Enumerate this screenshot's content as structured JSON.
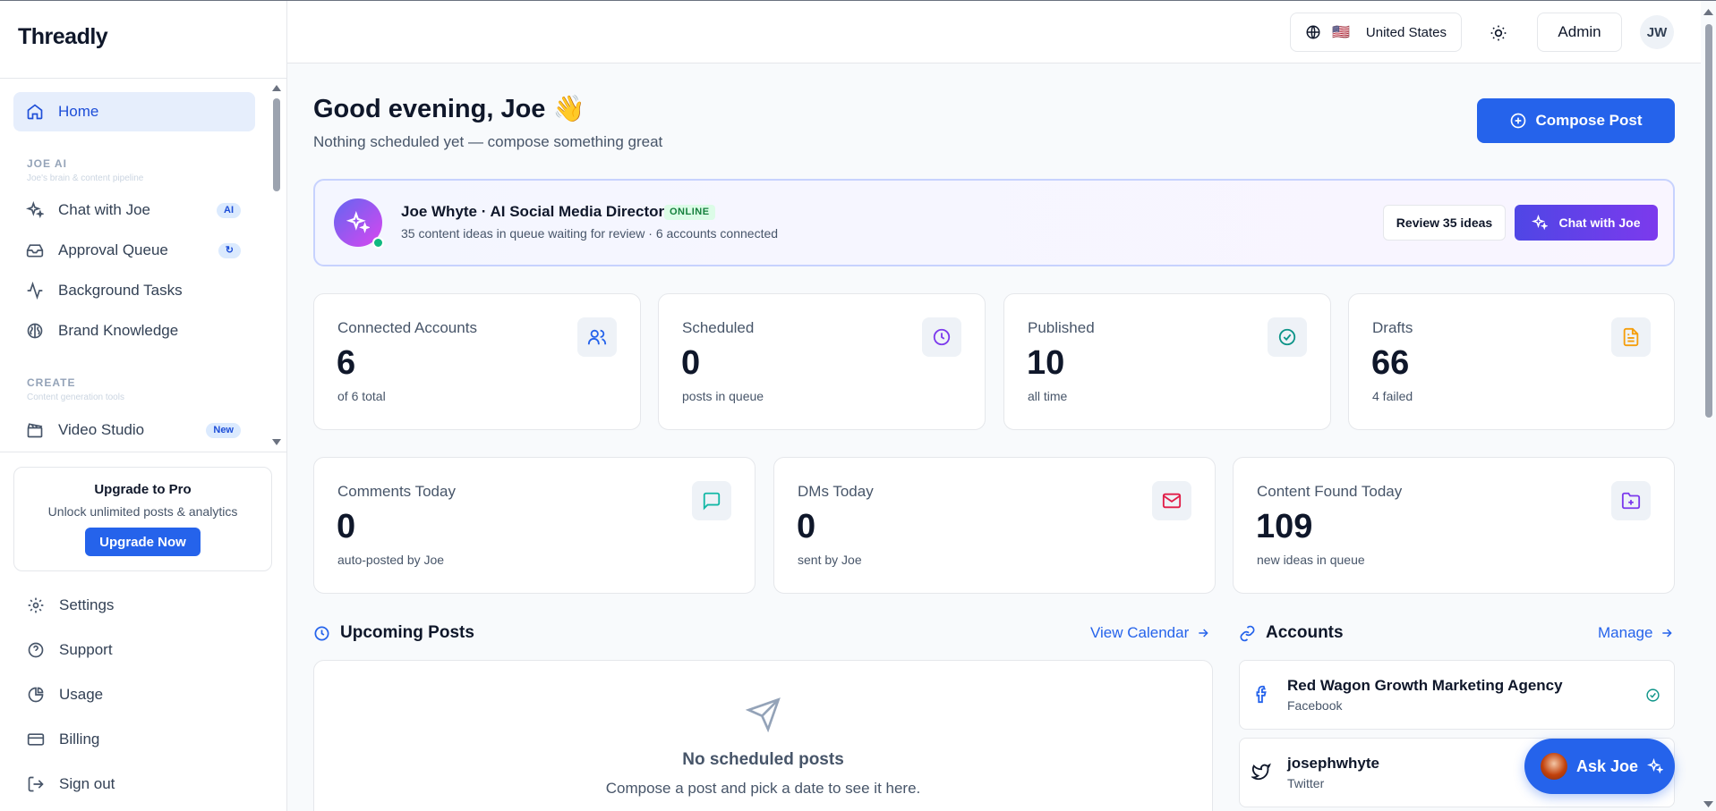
{
  "app": {
    "name": "Threadly"
  },
  "sidebar": {
    "nav": [
      {
        "label": "Home",
        "active": true
      },
      {
        "label": "Chat with Joe",
        "badge": "AI"
      },
      {
        "label": "Approval Queue",
        "badge": "↻"
      },
      {
        "label": "Background Tasks"
      },
      {
        "label": "Brand Knowledge"
      },
      {
        "label": "Video Studio",
        "badge": "New"
      }
    ],
    "sections": [
      {
        "title": "JOE AI",
        "subtitle": "Joe's brain & content pipeline"
      },
      {
        "title": "CREATE",
        "subtitle": "Content generation tools"
      }
    ],
    "upgrade": {
      "title": "Upgrade to Pro",
      "subtitle": "Unlock unlimited posts & analytics",
      "button": "Upgrade Now"
    },
    "footer": [
      {
        "label": "Settings",
        "icon": "gear-icon"
      },
      {
        "label": "Support",
        "icon": "help-circle-icon"
      },
      {
        "label": "Usage",
        "icon": "pie-chart-icon"
      },
      {
        "label": "Billing",
        "icon": "credit-card-icon"
      },
      {
        "label": "Sign out",
        "icon": "sign-out-icon"
      }
    ]
  },
  "topbar": {
    "region": "United States",
    "flag": "🇺🇸",
    "role": "Admin",
    "avatar_initials": "JW"
  },
  "header": {
    "greeting": "Good evening, Joe",
    "emoji": "👋",
    "subtitle": "Nothing scheduled yet — compose something great",
    "compose_label": "Compose Post"
  },
  "ai_card": {
    "name": "Joe Whyte · AI Social Media Director",
    "status": "ONLINE",
    "subtitle": "35 content ideas in queue waiting for review · 6 accounts connected",
    "review_label": "Review 35 ideas",
    "chat_label": "Chat with Joe"
  },
  "stats_row1": [
    {
      "label": "Connected Accounts",
      "value": "6",
      "sub": "of 6 total",
      "icon": "users-icon",
      "color": "#2563eb"
    },
    {
      "label": "Scheduled",
      "value": "0",
      "sub": "posts in queue",
      "icon": "clock-icon",
      "color": "#7c3aed"
    },
    {
      "label": "Published",
      "value": "10",
      "sub": "all time",
      "icon": "check-circle-icon",
      "color": "#0d9488"
    },
    {
      "label": "Drafts",
      "value": "66",
      "sub": "4 failed",
      "icon": "file-text-icon",
      "color": "#f59e0b"
    }
  ],
  "stats_row2": [
    {
      "label": "Comments Today",
      "value": "0",
      "sub": "auto-posted by Joe",
      "icon": "message-square-icon",
      "color": "#14b8a6"
    },
    {
      "label": "DMs Today",
      "value": "0",
      "sub": "sent by Joe",
      "icon": "mail-icon",
      "color": "#e11d48"
    },
    {
      "label": "Content Found Today",
      "value": "109",
      "sub": "new ideas in queue",
      "icon": "folder-plus-icon",
      "color": "#7c3aed"
    }
  ],
  "upcoming": {
    "title": "Upcoming Posts",
    "link": "View Calendar",
    "empty_title": "No scheduled posts",
    "empty_sub": "Compose a post and pick a date to see it here."
  },
  "accounts": {
    "title": "Accounts",
    "link": "Manage",
    "items": [
      {
        "name": "Red Wagon Growth Marketing Agency",
        "platform": "Facebook"
      },
      {
        "name": "josephwhyte",
        "platform": "Twitter"
      }
    ]
  },
  "ask_joe": {
    "label": "Ask Joe"
  }
}
